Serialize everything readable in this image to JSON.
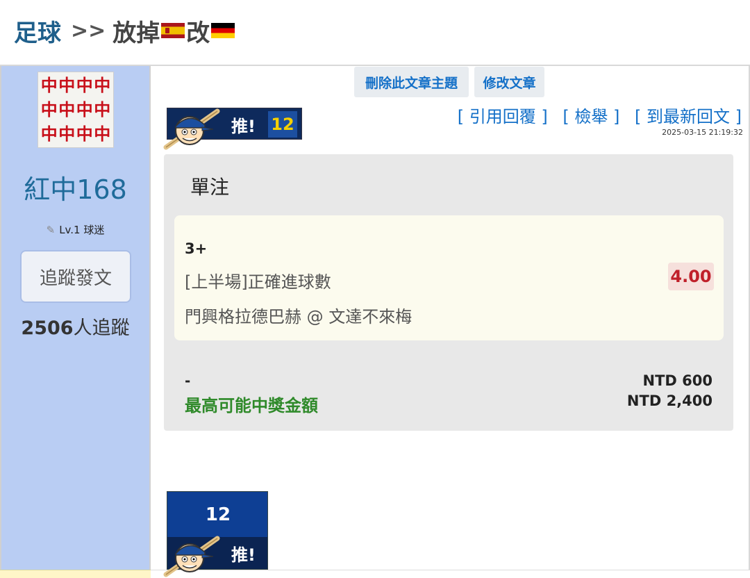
{
  "breadcrumb": {
    "board": "足球",
    "separator": ">>",
    "title_part1": "放掉",
    "title_part2": "改",
    "flag_1": "spain-flag-icon",
    "flag_2": "germany-flag-icon"
  },
  "author": {
    "avatar_icon": "red-dragon-mahjong-tiles-icon",
    "avatar_tile": "中",
    "name": "紅中168",
    "level": "Lv.1 球迷",
    "follow_button": "追蹤發文",
    "follower_count": "2506",
    "follower_suffix": "人追蹤"
  },
  "toolbar": {
    "delete_topic": "刪除此文章主題",
    "edit_post": "修改文章"
  },
  "push": {
    "label": "推!",
    "count": "12"
  },
  "actions": {
    "quote_reply": "[ 引用回覆 ]",
    "report": "[ 檢舉 ]",
    "latest_reply": "[ 到最新回文 ]"
  },
  "post": {
    "timestamp": "2025-03-15 21:19:32"
  },
  "bet": {
    "type": "單注",
    "pick": "3+",
    "market": "[上半場]正確進球數",
    "match": "門興格拉德巴赫 @ 文達不來梅",
    "odds": "4.00",
    "stake_label": "-",
    "stake": "NTD 600",
    "payout_label": "最高可能中獎金額",
    "payout": "NTD 2,400"
  },
  "colors": {
    "sidebar_bg": "#b9cdf3",
    "link_blue": "#1470c8",
    "odds_red": "#c0202a",
    "payout_green": "#2f8a2a",
    "push_badge_navy": "#0e2a5c",
    "push_count_yellow": "#f6d000"
  }
}
